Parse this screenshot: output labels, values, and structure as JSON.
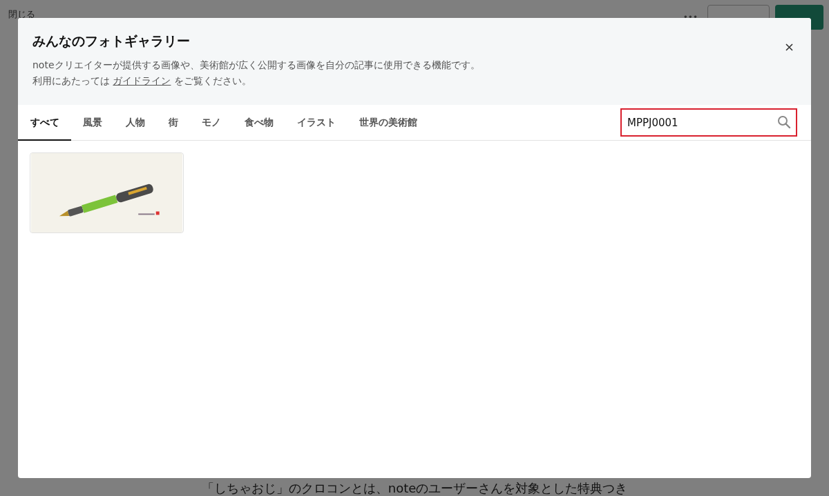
{
  "page": {
    "close_link": "閉じる",
    "more_button": "•••",
    "body_text": "「しちゃおじ」のクロコンとは、noteのユーザーさんを対象とした特典つき"
  },
  "modal": {
    "title": "みんなのフォトギャラリー",
    "description": "noteクリエイターが提供する画像や、美術館が広く公開する画像を自分の記事に使用できる機能です。",
    "guide_prefix": "利用にあたっては",
    "guide_link": "ガイドライン",
    "guide_suffix": "をご覧ください。",
    "tabs": [
      {
        "label": "すべて",
        "selected": true
      },
      {
        "label": "風景",
        "selected": false
      },
      {
        "label": "人物",
        "selected": false
      },
      {
        "label": "街",
        "selected": false
      },
      {
        "label": "モノ",
        "selected": false
      },
      {
        "label": "食べ物",
        "selected": false
      },
      {
        "label": "イラスト",
        "selected": false
      },
      {
        "label": "世界の美術館",
        "selected": false
      }
    ],
    "search": {
      "value": "MPPJ0001"
    }
  }
}
